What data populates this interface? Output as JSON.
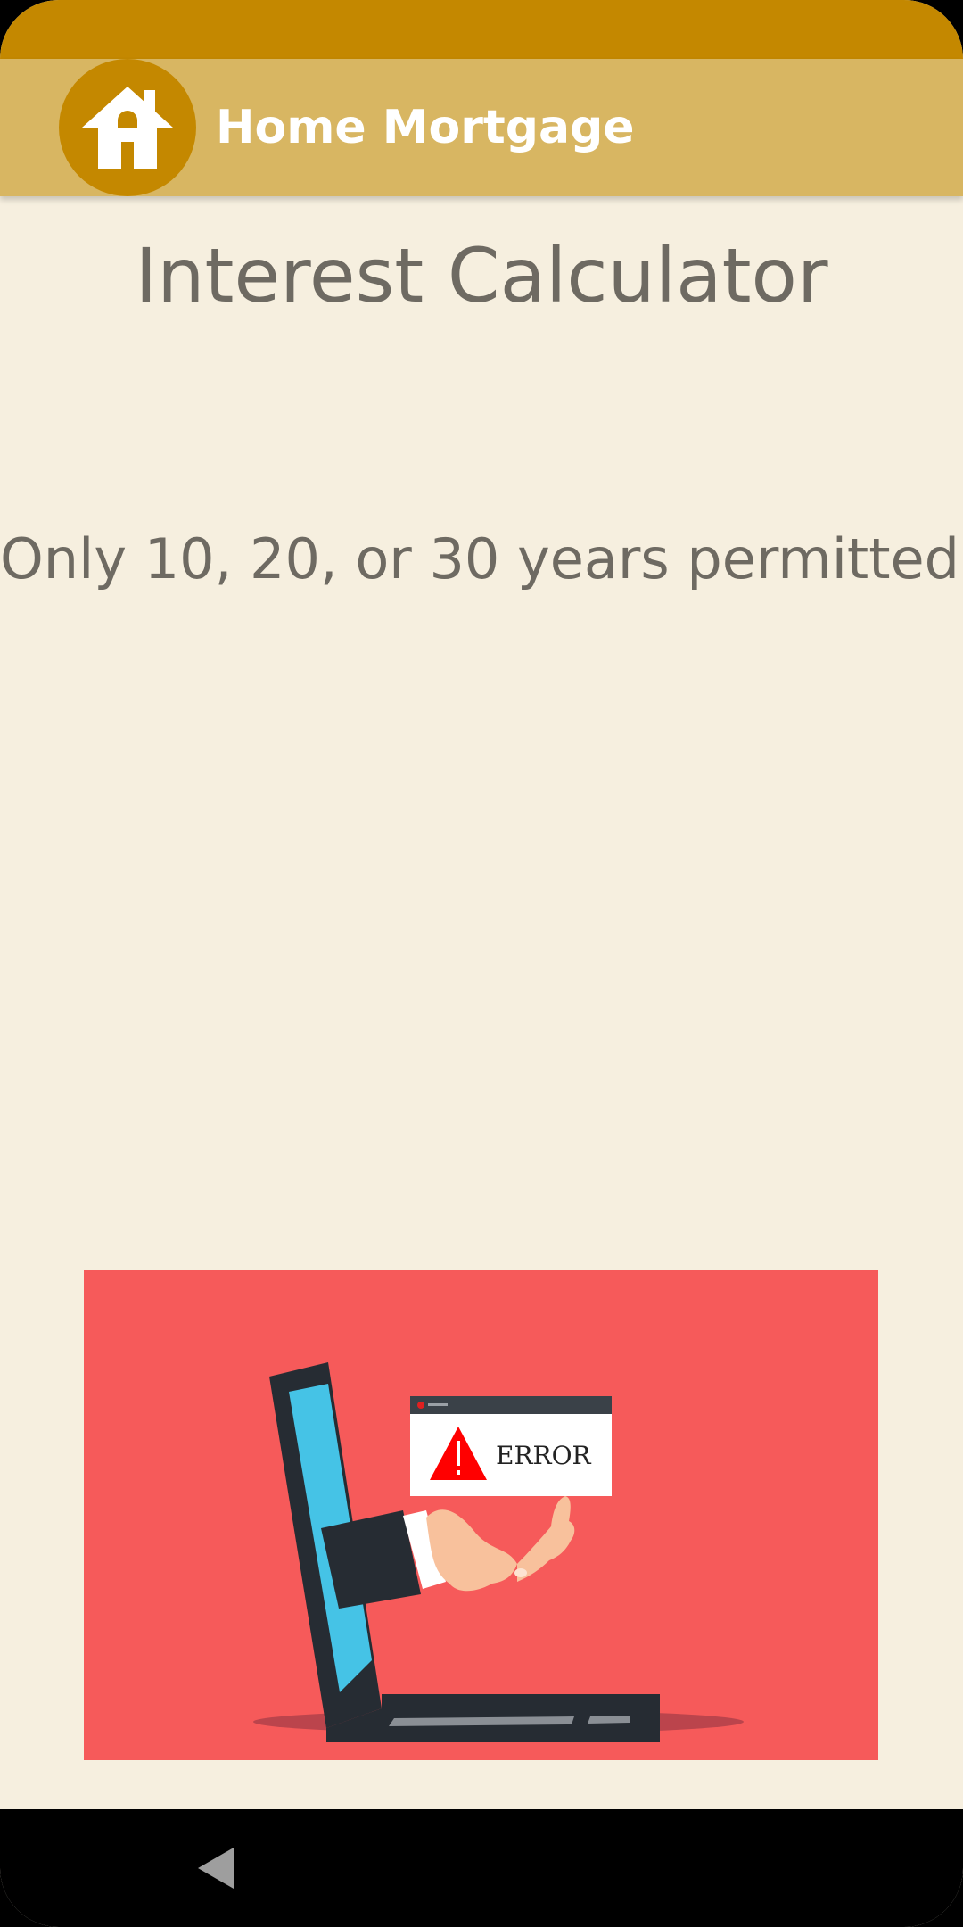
{
  "app_bar": {
    "title": "Home Mortgage",
    "logo_icon": "house-icon"
  },
  "main": {
    "title": "Interest Calculator",
    "message": "Only 10, 20, or 30 years permitted."
  },
  "illustration": {
    "error_label": "ERROR",
    "error_icon": "warning-triangle-icon"
  },
  "nav_bar": {
    "back_icon": "back-triangle-icon"
  },
  "colors": {
    "status_bar": "#c48800",
    "app_bar": "#d8b662",
    "background": "#f6efdf",
    "text": "#6e6a62",
    "illustration_bg": "#f65a5a"
  }
}
